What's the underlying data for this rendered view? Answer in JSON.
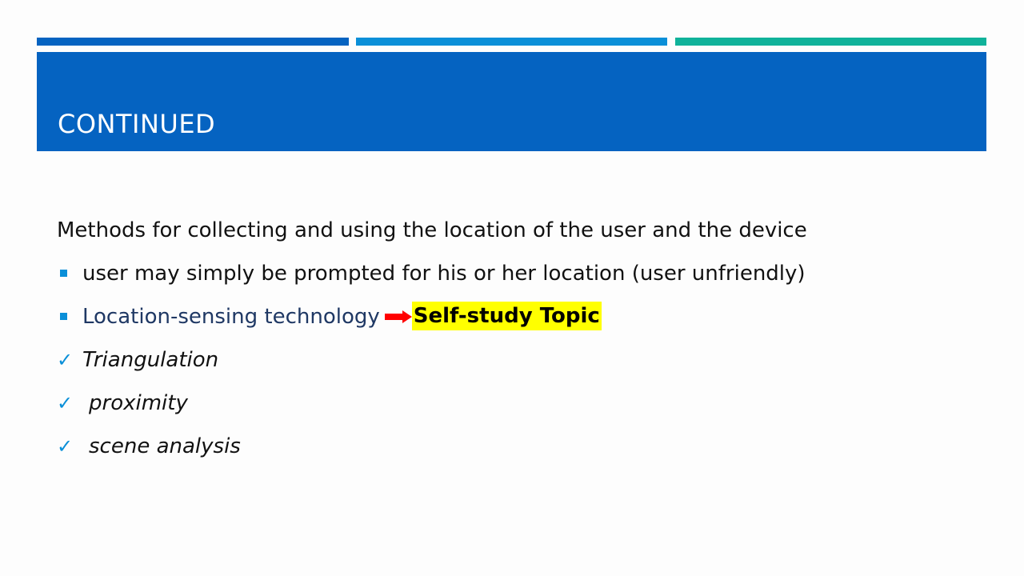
{
  "slide": {
    "title": "CONTINUED",
    "intro": "Methods for collecting and using the location of the user and the device",
    "bullets": [
      {
        "text": "user may simply be prompted for his or her location (user unfriendly)"
      },
      {
        "text": "Location-sensing technology",
        "highlight": "Self-study Topic"
      }
    ],
    "checks": [
      {
        "text": "Triangulation"
      },
      {
        "text": "proximity"
      },
      {
        "text": "scene analysis"
      }
    ],
    "icons": {
      "bullet": "square-bullet-icon",
      "check": "checkmark-icon",
      "arrow": "right-arrow-icon",
      "check_glyph": "✓"
    }
  },
  "colors": {
    "accent_1": "#0563c1",
    "accent_2": "#0a8fd8",
    "accent_3": "#10b29a",
    "title_band": "#0563c1",
    "bullet": "#0a8fd8",
    "arrow": "#ff0000",
    "highlight": "#ffff00"
  }
}
